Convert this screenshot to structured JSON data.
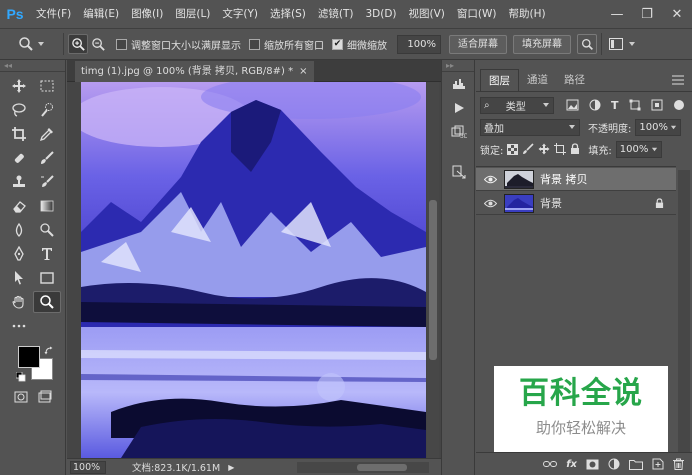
{
  "menubar": {
    "logo": "Ps",
    "items": [
      "文件(F)",
      "编辑(E)",
      "图像(I)",
      "图层(L)",
      "文字(Y)",
      "选择(S)",
      "滤镜(T)",
      "3D(D)",
      "视图(V)",
      "窗口(W)",
      "帮助(H)"
    ],
    "window_controls": [
      "—",
      "❐",
      "✕"
    ]
  },
  "options": {
    "cb1": "调整窗口大小以满屏显示",
    "cb2": "缩放所有窗口",
    "cb3": "细微缩放",
    "cb1_checked": false,
    "cb2_checked": false,
    "cb3_checked": true,
    "zoom_value": "100%",
    "fit_button": "适合屏幕",
    "fill_button": "填充屏幕"
  },
  "document": {
    "tab_title": "timg (1).jpg @ 100% (背景 拷贝, RGB/8#) *",
    "tab_close": "×"
  },
  "status": {
    "zoom": "100%",
    "doc_info": "文档:823.1K/1.61M"
  },
  "layers_panel": {
    "tabs": [
      "图层",
      "通道",
      "路径"
    ],
    "filter_kind": "类型",
    "blend_mode": "叠加",
    "opacity_label": "不透明度:",
    "opacity_value": "100%",
    "lock_label": "锁定:",
    "fill_label": "填充:",
    "fill_value": "100%",
    "layers": [
      {
        "name": "背景 拷贝",
        "selected": true,
        "locked": false
      },
      {
        "name": "背景",
        "selected": false,
        "locked": true
      }
    ],
    "footer_fx": "fx"
  },
  "watermark": {
    "title": "百科全说",
    "subtitle": "助你轻松解决"
  },
  "colors": {
    "accent": "#31a8ff",
    "panel_bg": "#535353",
    "watermark_green": "#27a64a"
  }
}
